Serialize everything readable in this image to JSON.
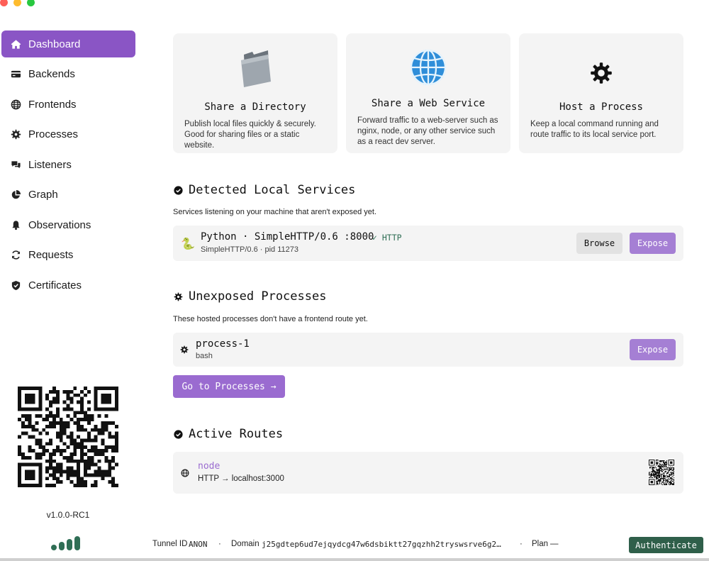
{
  "sidebar": {
    "items": [
      {
        "label": "Dashboard",
        "icon": "home-icon",
        "active": true
      },
      {
        "label": "Backends",
        "icon": "credit-card-icon"
      },
      {
        "label": "Frontends",
        "icon": "globe-icon"
      },
      {
        "label": "Processes",
        "icon": "gear-icon"
      },
      {
        "label": "Listeners",
        "icon": "chat-bubbles-icon"
      },
      {
        "label": "Graph",
        "icon": "pie-chart-icon"
      },
      {
        "label": "Observations",
        "icon": "bell-icon"
      },
      {
        "label": "Requests",
        "icon": "refresh-icon"
      },
      {
        "label": "Certificates",
        "icon": "shield-check-icon"
      }
    ],
    "version": "v1.0.0-RC1"
  },
  "cards": [
    {
      "title": "Share a Directory",
      "description": "Publish local files quickly & securely. Good for sharing files or a static website.",
      "icon": "folder-icon"
    },
    {
      "title": "Share a Web Service",
      "description": "Forward traffic to a web-server such as nginx, node, or any other service such as a react dev server.",
      "icon": "globe-icon"
    },
    {
      "title": "Host a Process",
      "description": "Keep a local command running and route traffic to its local service port.",
      "icon": "gear-icon"
    }
  ],
  "detected": {
    "title": "Detected Local Services",
    "subtitle": "Services listening on your machine that aren't exposed yet.",
    "service": {
      "name": "Python · SimpleHTTP/0.6 :8000",
      "protocol": "✓ HTTP",
      "detail": "SimpleHTTP/0.6 · pid 11273",
      "browse_label": "Browse",
      "expose_label": "Expose"
    }
  },
  "unexposed": {
    "title": "Unexposed Processes",
    "subtitle": "These hosted processes don't have a frontend route yet.",
    "process": {
      "name": "process-1",
      "detail": "bash",
      "expose_label": "Expose"
    },
    "goto_label": "Go to Processes →"
  },
  "routes": {
    "title": "Active Routes",
    "route": {
      "name": "node",
      "detail": "HTTP → localhost:3000"
    }
  },
  "footer": {
    "tunnel_label": "Tunnel ID",
    "tunnel_value": "ANON",
    "sep": "·",
    "domain_label": "Domain",
    "domain_value": "j25gdtep6ud7ejqydcg47w6dsbiktt27gqzhh2tryswsrve6g2…",
    "plan_label": "Plan",
    "plan_value": "—",
    "auth_label": "Authenticate"
  },
  "colors": {
    "accent": "#8a55c5",
    "expose": "#a57fd4",
    "auth": "#2f5f4a",
    "link": "#9a6bd0"
  }
}
